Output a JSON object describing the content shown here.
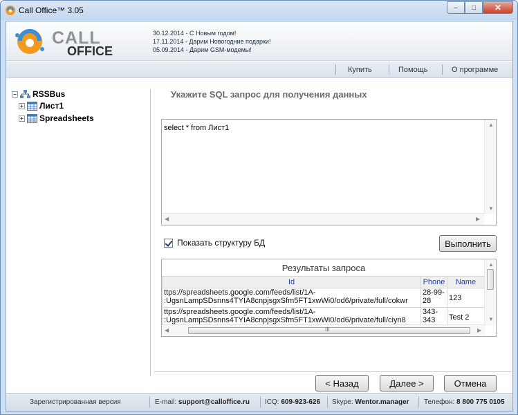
{
  "window": {
    "title": "Call Office™ 3.05",
    "controls": {
      "minimize": "–",
      "maximize": "□",
      "close": "✕"
    }
  },
  "logo": {
    "line1": "CALL",
    "line2": "OFFICE"
  },
  "news": [
    "30.12.2014 - С Новым годом!",
    "17.11.2014 - Дарим Новогодние подарки!",
    "05.09.2014 - Дарим GSM-модемы!"
  ],
  "menu": {
    "buy": "Купить",
    "help": "Помощь",
    "about": "О программе"
  },
  "tree": {
    "root": "RSSBus",
    "children": [
      "Лист1",
      "Spreadsheets"
    ],
    "expand_root": "−",
    "expand_child": "+"
  },
  "main": {
    "prompt": "Укажите SQL запрос для получения данных",
    "sql_query": "select * from Лист1",
    "show_structure_label": "Показать структуру БД",
    "show_structure_checked": true,
    "execute_label": "Выполнить"
  },
  "results": {
    "title": "Результаты запроса",
    "columns": [
      "Id",
      "Phone",
      "Name"
    ],
    "rows": [
      [
        "ttps://spreadsheets.google.com/feeds/list/1A-\n:UgsnLampSDsnns4TYIA8cnpjsgxSfm5FT1xwWi0/od6/private/full/cokwr",
        "28-99-\n28",
        "123"
      ],
      [
        "ttps://spreadsheets.google.com/feeds/list/1A-\n:UgsnLampSDsnns4TYIA8cnpjsgxSfm5FT1xwWi0/od6/private/full/ciyn8",
        "343-\n343",
        "Test 2"
      ]
    ],
    "hscroll_glyph": "III"
  },
  "nav": {
    "back": "< Назад",
    "next": "Далее >",
    "cancel": "Отмена"
  },
  "status": {
    "version": "Зарегистрированная версия",
    "email_label": "E-mail:",
    "email": "support@calloffice.ru",
    "icq_label": "ICQ:",
    "icq": "609-923-626",
    "skype_label": "Skype:",
    "skype": "Wentor.manager",
    "phone_label": "Телефон:",
    "phone": "8 800 775 0105"
  },
  "colors": {
    "accent": "#2244aa",
    "prompt_gray": "#6b6b6b",
    "close_red": "#c4412a",
    "logo_orange": "#f39a1e",
    "logo_blue": "#3a8fd8"
  },
  "icons": [
    "app-icon",
    "logo-icon",
    "database-icon",
    "table-icon",
    "checkbox-icon"
  ]
}
